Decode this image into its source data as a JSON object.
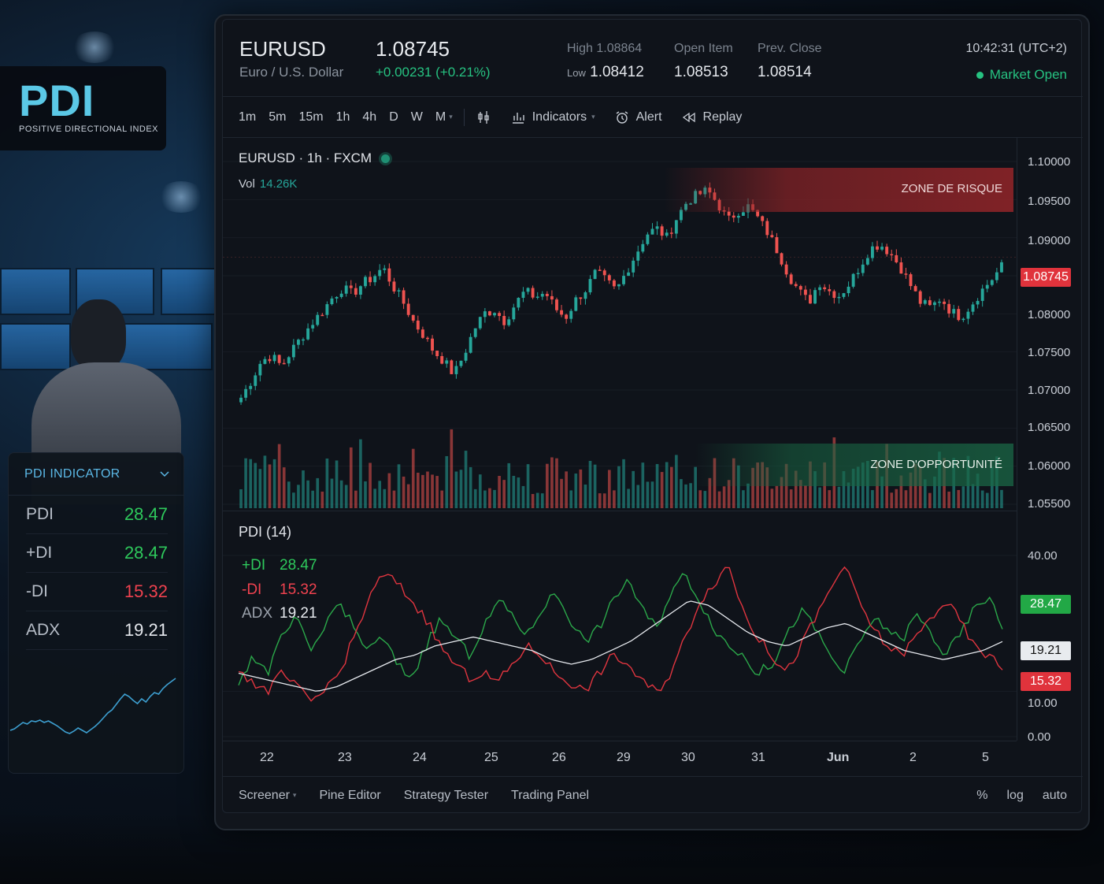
{
  "brand": {
    "title": "PDI",
    "subtitle": "POSITIVE DIRECTIONAL INDEX"
  },
  "side_panel": {
    "title": "PDI INDICATOR",
    "rows": [
      {
        "label": "PDI",
        "value": "28.47",
        "color": "#2ec95c"
      },
      {
        "label": "+DI",
        "value": "28.47",
        "color": "#2ec95c"
      },
      {
        "label": "-DI",
        "value": "15.32",
        "color": "#f0424f"
      },
      {
        "label": "ADX",
        "value": "19.21",
        "color": "#e6e9ee"
      }
    ],
    "sparkline": [
      12,
      14,
      18,
      22,
      20,
      24,
      23,
      25,
      22,
      24,
      21,
      18,
      14,
      10,
      8,
      11,
      15,
      12,
      9,
      13,
      17,
      22,
      28,
      34,
      38,
      45,
      52,
      58,
      55,
      50,
      46,
      52,
      48,
      55,
      60,
      58,
      65,
      70,
      74,
      78
    ]
  },
  "header": {
    "symbol": "EURUSD",
    "description": "Euro / U.S. Dollar",
    "price": "1.08745",
    "change": "+0.00231 (+0.21%)",
    "stats": [
      {
        "label": "High 1.08864",
        "value": ""
      },
      {
        "label": "Low",
        "value": "1.08412"
      },
      {
        "label": "Open Item",
        "value": "1.08513"
      },
      {
        "label": "Prev. Close",
        "value": "1.08514"
      }
    ],
    "clock": "10:42:31 (UTC+2)",
    "market_status": "Market Open"
  },
  "toolbar": {
    "timeframes": [
      "1m",
      "5m",
      "15m",
      "1h",
      "4h",
      "D",
      "W",
      "M"
    ],
    "indicators_label": "Indicators",
    "alert_label": "Alert",
    "replay_label": "Replay"
  },
  "chart": {
    "legend": "EURUSD · 1h · FXCM",
    "vol_label": "Vol",
    "vol_value": "14.26K",
    "zone_risk": "ZONE DE RISQUE",
    "zone_opportunity": "ZONE D'OPPORTUNITÉ",
    "price_axis": [
      "1.10000",
      "1.09500",
      "1.09000",
      "1.08745",
      "1.08000",
      "1.07500",
      "1.07000",
      "1.06500",
      "1.06000",
      "1.05500"
    ],
    "current_price_badge": "1.08745",
    "indicator_title": "PDI (14)",
    "indicator_legend": [
      {
        "key": "+DI",
        "value": "28.47",
        "color": "#2ec95c"
      },
      {
        "key": "-DI",
        "value": "15.32",
        "color": "#f0424f"
      },
      {
        "key": "ADX",
        "value": "19.21",
        "color": "#e6e9ee"
      }
    ],
    "indicator_axis": [
      "40.00",
      "10.00",
      "0.00"
    ],
    "badge_pdi": "28.47",
    "badge_adx": "19.21",
    "badge_mdi": "15.32",
    "colors": {
      "up": "#26a69a",
      "down": "#ef5350",
      "plus_di": "#2ba84a",
      "minus_di": "#e0353f",
      "adx": "#e6e9ee"
    },
    "time_axis": [
      "22",
      "23",
      "24",
      "25",
      "26",
      "29",
      "30",
      "31",
      "Jun",
      "2",
      "5"
    ]
  },
  "chart_data": {
    "type": "candlestick",
    "price_close_path": [
      1.069,
      1.0712,
      1.0738,
      1.0745,
      1.0731,
      1.0752,
      1.077,
      1.0788,
      1.0803,
      1.0821,
      1.0834,
      1.0826,
      1.084,
      1.0848,
      1.0861,
      1.0836,
      1.0815,
      1.079,
      1.0772,
      1.0751,
      1.0738,
      1.072,
      1.0747,
      1.078,
      1.0801,
      1.0805,
      1.079,
      1.0812,
      1.083,
      1.0822,
      1.0828,
      1.0807,
      1.0795,
      1.0818,
      1.0832,
      1.0855,
      1.0843,
      1.083,
      1.0856,
      1.088,
      1.0905,
      1.0912,
      1.09,
      1.0927,
      1.0948,
      1.0956,
      1.0962,
      1.0945,
      1.0922,
      1.0935,
      1.0941,
      1.0925,
      1.0905,
      1.088,
      1.0851,
      1.083,
      1.0815,
      1.0842,
      1.083,
      1.0824,
      1.084,
      1.0862,
      1.0885,
      1.0892,
      1.088,
      1.0862,
      1.0838,
      1.0815,
      1.0808,
      1.0821,
      1.0803,
      1.0796,
      1.0812,
      1.083,
      1.0845,
      1.0862
    ],
    "plus_di": [
      12,
      18,
      14,
      22,
      26,
      19,
      24,
      30,
      24,
      19,
      22,
      16,
      13,
      20,
      26,
      22,
      18,
      24,
      30,
      27,
      22,
      28,
      32,
      26,
      21,
      24,
      30,
      35,
      28,
      24,
      32,
      36,
      30,
      24,
      20,
      18,
      14,
      16,
      22,
      28,
      24,
      18,
      14,
      20,
      26,
      24,
      21,
      27,
      23,
      18,
      22,
      28,
      31,
      24
    ],
    "minus_di": [
      15,
      12,
      10,
      14,
      11,
      8,
      10,
      14,
      22,
      30,
      36,
      34,
      30,
      26,
      20,
      16,
      13,
      14,
      12,
      16,
      20,
      18,
      14,
      12,
      10,
      14,
      18,
      16,
      12,
      10,
      14,
      22,
      30,
      34,
      38,
      28,
      22,
      18,
      14,
      20,
      26,
      32,
      38,
      30,
      24,
      20,
      18,
      22,
      26,
      30,
      26,
      20,
      18,
      15
    ],
    "adx": [
      14,
      13,
      12,
      11,
      10,
      11,
      13,
      15,
      17,
      18,
      20,
      21,
      22,
      21,
      20,
      19,
      17,
      16,
      17,
      19,
      21,
      24,
      27,
      30,
      29,
      26,
      23,
      21,
      20,
      22,
      24,
      25,
      23,
      21,
      19,
      18,
      17,
      18,
      19,
      21
    ],
    "ylim_price": [
      1.055,
      1.1
    ],
    "ylim_indicator": [
      0,
      40
    ]
  }
}
